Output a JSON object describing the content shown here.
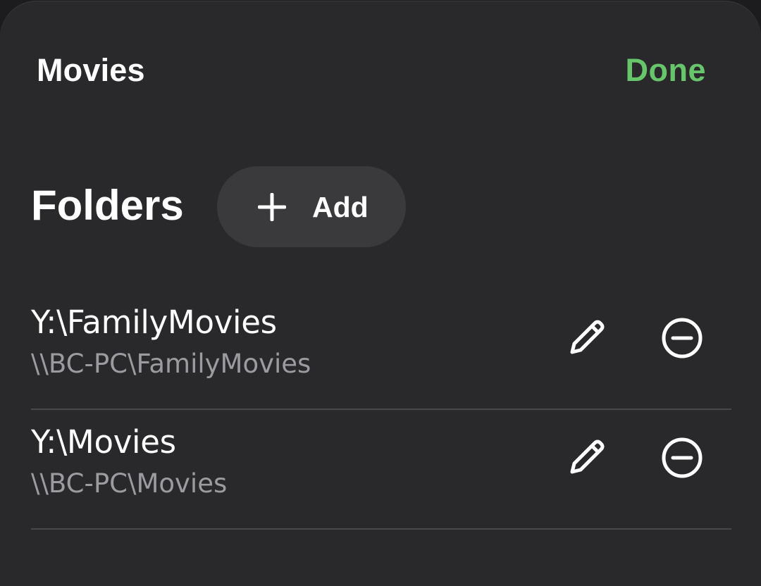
{
  "header": {
    "title": "Movies",
    "done_label": "Done",
    "done_color": "#67c56b"
  },
  "section": {
    "title": "Folders",
    "add_label": "Add",
    "add_icon": "plus-icon"
  },
  "folders": [
    {
      "path": "Y:\\FamilyMovies",
      "network_path": "\\\\BC-PC\\FamilyMovies",
      "edit_icon": "pencil-icon",
      "remove_icon": "minus-circle-icon"
    },
    {
      "path": "Y:\\Movies",
      "network_path": "\\\\BC-PC\\Movies",
      "edit_icon": "pencil-icon",
      "remove_icon": "minus-circle-icon"
    }
  ]
}
